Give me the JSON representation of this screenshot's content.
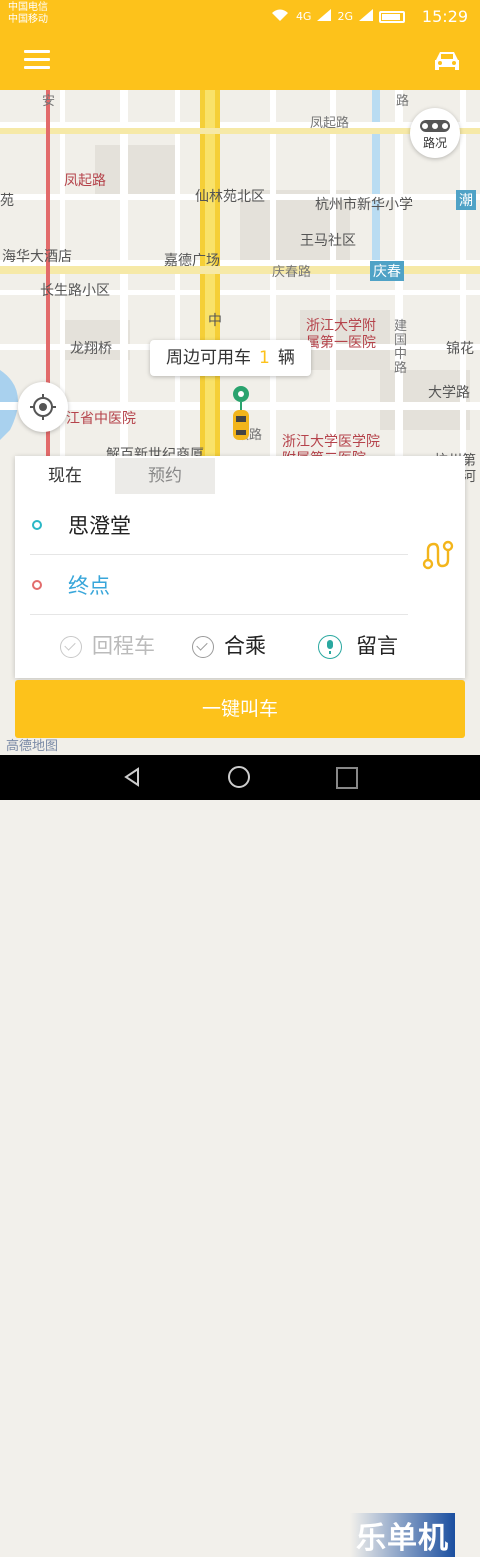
{
  "status_bar": {
    "carrier_1": "中国电信",
    "carrier_2": "中国移动",
    "network_1": "4G",
    "network_2": "2G",
    "time": "15:29"
  },
  "app_bar": {
    "menu_icon": "menu-icon",
    "car_icon": "car-icon"
  },
  "map": {
    "labels": [
      "凤起路",
      "仙林苑北区",
      "杭州市新华小学",
      "凤起路",
      "潮",
      "海华大酒店",
      "嘉德广场",
      "王马社区",
      "庆春路",
      "庆春",
      "长生路小区",
      "浙江大学附属第一医院",
      "龙翔桥",
      "中",
      "建国中路",
      "锦花",
      "大学路",
      "江省中医院",
      "解百新世纪商厦",
      "浙江大学医学院附属第二医院",
      "杭州第",
      "学东河",
      "苑",
      "路",
      "安",
      "政路"
    ],
    "traffic_button": "路况",
    "locate_icon": "locate-icon",
    "bubble_prefix": "周边可用车",
    "bubble_count": "1",
    "bubble_suffix": "辆",
    "map_logo": "高德地图"
  },
  "booking": {
    "tabs": [
      "现在",
      "预约"
    ],
    "active_tab": "现在",
    "origin": "思澄堂",
    "destination_placeholder": "终点",
    "options": [
      {
        "label": "回程车",
        "enabled": false
      },
      {
        "label": "合乘",
        "enabled": true
      },
      {
        "label": "留言",
        "enabled": true
      }
    ],
    "call_button": "一键叫车"
  },
  "watermark": "乐单机",
  "colors": {
    "brand": "#fdc21b",
    "origin_dot": "#2ab7c6",
    "destination_dot": "#e36c6c",
    "destination_text": "#38a6da"
  }
}
